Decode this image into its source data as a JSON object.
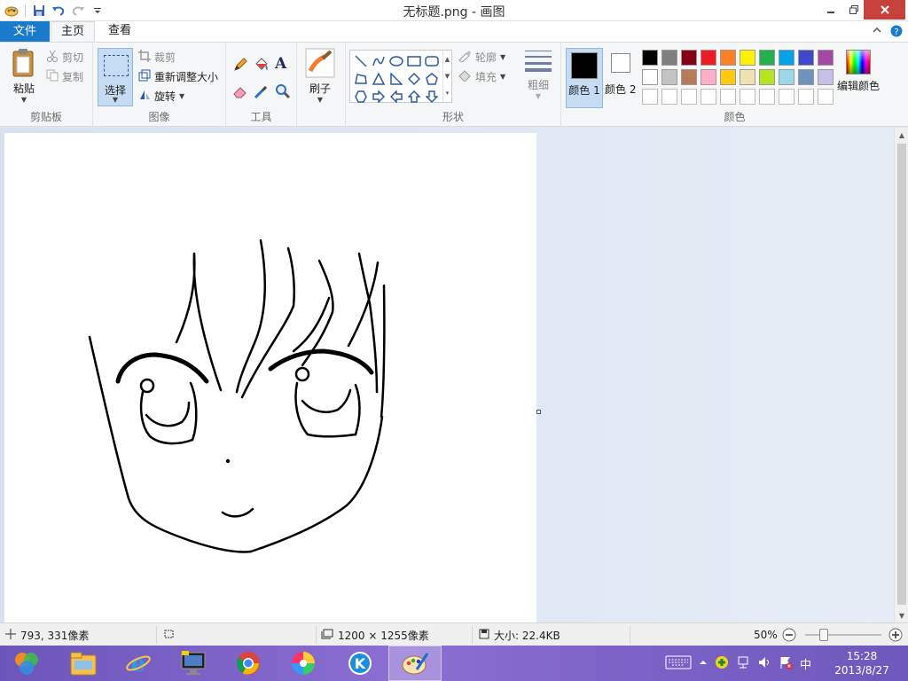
{
  "window": {
    "title": "无标题.png - 画图"
  },
  "tabs": {
    "file": "文件",
    "home": "主页",
    "view": "查看"
  },
  "clipboard": {
    "group": "剪贴板",
    "paste": "粘贴",
    "cut": "剪切",
    "copy": "复制"
  },
  "image": {
    "group": "图像",
    "select": "选择",
    "crop": "裁剪",
    "resize": "重新调整大小",
    "rotate": "旋转"
  },
  "tools": {
    "group": "工具"
  },
  "brushes": {
    "label": "刷子"
  },
  "shapes": {
    "group": "形状",
    "outline": "轮廓",
    "fill": "填充"
  },
  "size": {
    "label": "粗细"
  },
  "colors": {
    "group": "颜色",
    "color1": "颜色 1",
    "color2": "颜色 2",
    "edit": "编辑颜色",
    "palette": [
      "#000000",
      "#7f7f7f",
      "#880015",
      "#ed1c24",
      "#ff7f27",
      "#fff200",
      "#22b14c",
      "#00a2e8",
      "#3f48cc",
      "#a349a4",
      "#ffffff",
      "#c3c3c3",
      "#b97a57",
      "#ffaec9",
      "#ffc90e",
      "#efe4b0",
      "#b5e61d",
      "#99d9ea",
      "#7092be",
      "#c8bfe7",
      "#ffffff",
      "#ffffff",
      "#ffffff",
      "#ffffff",
      "#ffffff",
      "#ffffff",
      "#ffffff",
      "#ffffff",
      "#ffffff",
      "#ffffff"
    ]
  },
  "status": {
    "cursor": "793, 331像素",
    "dimensions": "1200 × 1255像素",
    "filesize": "大小: 22.4KB",
    "zoom": "50%"
  },
  "taskbar": {
    "apps": [
      "photo-gallery-icon",
      "file-explorer-icon",
      "internet-explorer-icon",
      "computer-icon",
      "chrome-icon",
      "media-icon",
      "kugou-icon",
      "paint-icon"
    ],
    "ime": "中",
    "time": "15:28",
    "date": "2013/8/27"
  }
}
